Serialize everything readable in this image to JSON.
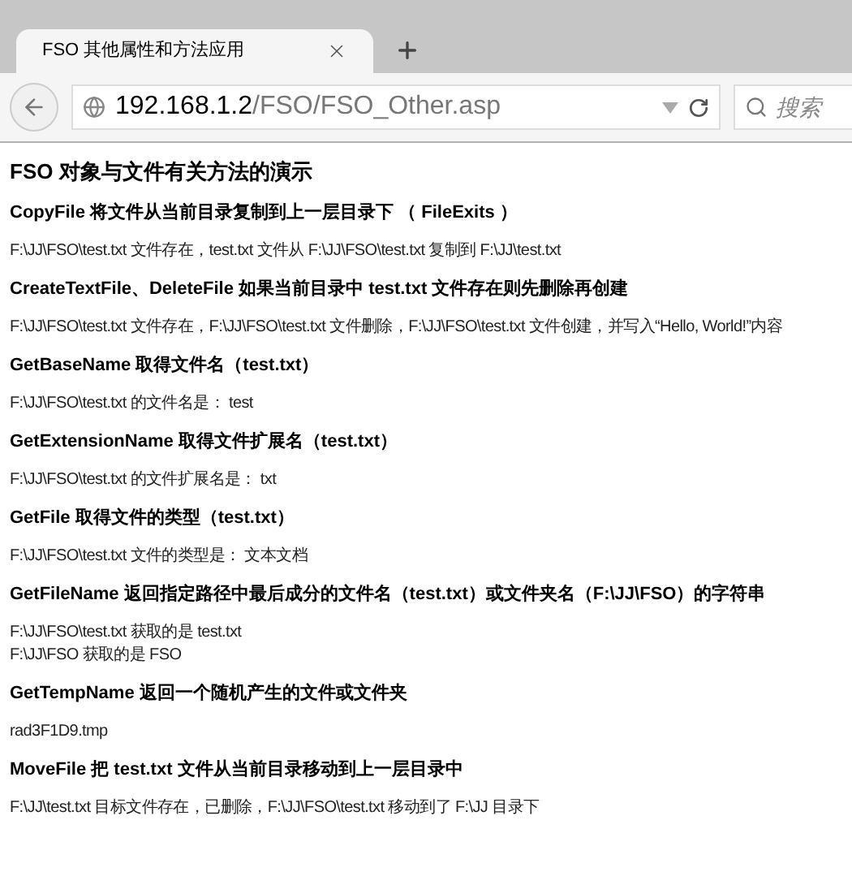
{
  "browser": {
    "tab_title": "FSO 其他属性和方法应用",
    "url_host": "192.168.1.2",
    "url_path": "/FSO/FSO_Other.asp",
    "search_placeholder": "搜索"
  },
  "page": {
    "title": "FSO 对象与文件有关方法的演示",
    "sections": [
      {
        "heading": "CopyFile 将文件从当前目录复制到上一层目录下 （ FileExits ）",
        "lines": [
          "F:\\JJ\\FSO\\test.txt 文件存在，test.txt 文件从 F:\\JJ\\FSO\\test.txt 复制到 F:\\JJ\\test.txt"
        ]
      },
      {
        "heading": "CreateTextFile、DeleteFile 如果当前目录中 test.txt 文件存在则先删除再创建",
        "lines": [
          "F:\\JJ\\FSO\\test.txt 文件存在，F:\\JJ\\FSO\\test.txt 文件删除，F:\\JJ\\FSO\\test.txt 文件创建，并写入“Hello, World!”内容"
        ]
      },
      {
        "heading": "GetBaseName 取得文件名（test.txt）",
        "lines": [
          "F:\\JJ\\FSO\\test.txt 的文件名是： test"
        ]
      },
      {
        "heading": "GetExtensionName 取得文件扩展名（test.txt）",
        "lines": [
          "F:\\JJ\\FSO\\test.txt 的文件扩展名是： txt"
        ]
      },
      {
        "heading": "GetFile 取得文件的类型（test.txt）",
        "lines": [
          "F:\\JJ\\FSO\\test.txt 文件的类型是： 文本文档"
        ]
      },
      {
        "heading": "GetFileName 返回指定路径中最后成分的文件名（test.txt）或文件夹名（F:\\JJ\\FSO）的字符串",
        "lines": [
          "F:\\JJ\\FSO\\test.txt 获取的是 test.txt",
          "F:\\JJ\\FSO 获取的是 FSO"
        ]
      },
      {
        "heading": "GetTempName 返回一个随机产生的文件或文件夹",
        "lines": [
          "rad3F1D9.tmp"
        ]
      },
      {
        "heading": "MoveFile 把 test.txt 文件从当前目录移动到上一层目录中",
        "lines": [
          "F:\\JJ\\test.txt 目标文件存在，已删除，F:\\JJ\\FSO\\test.txt 移动到了 F:\\JJ 目录下"
        ]
      }
    ]
  }
}
